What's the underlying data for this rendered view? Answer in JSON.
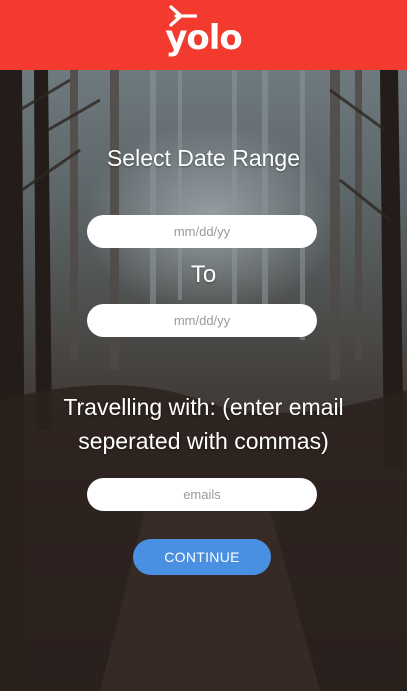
{
  "header": {
    "logo_text": "yolo",
    "background_color": "#f23a2e",
    "logo_icon": "plane-icon"
  },
  "date_range": {
    "title": "Select Date Range",
    "start_placeholder": "mm/dd/yy",
    "to_label": "To",
    "end_placeholder": "mm/dd/yy"
  },
  "travellers": {
    "label": "Travelling with: (enter email seperated with commas)",
    "placeholder": "emails"
  },
  "actions": {
    "continue_label": "CONTINUE",
    "continue_color": "#4a90e2"
  }
}
